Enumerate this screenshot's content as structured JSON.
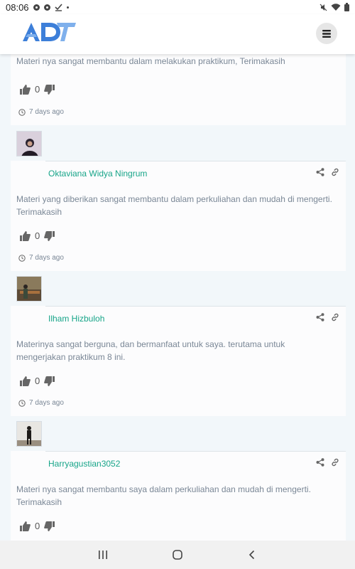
{
  "status_bar": {
    "time": "08:06"
  },
  "header": {
    "logo_alt": "ADT",
    "menu_icon": "hamburger-icon"
  },
  "comments": [
    {
      "text": "Materi nya sangat membantu dalam melakukan praktikum, Terimakasih",
      "likes": "0",
      "time": "7 days ago"
    },
    {
      "author": "Oktaviana Widya Ningrum",
      "text": "Materi yang diberikan sangat membantu dalam perkuliahan dan mudah di mengerti. Terimakasih",
      "likes": "0",
      "time": "7 days ago"
    },
    {
      "author": "Ilham Hizbuloh",
      "text": "Materinya sangat berguna, dan bermanfaat untuk saya. terutama untuk mengerjakan praktikum 8 ini.",
      "likes": "0",
      "time": "7 days ago"
    },
    {
      "author": "Harryagustian3052",
      "text": "Materi nya sangat membantu saya dalam perkuliahan dan mudah di mengerti. Terimakasih",
      "likes": "0"
    }
  ],
  "colors": {
    "accent": "#17a589",
    "logo": "#3d7fd9"
  }
}
